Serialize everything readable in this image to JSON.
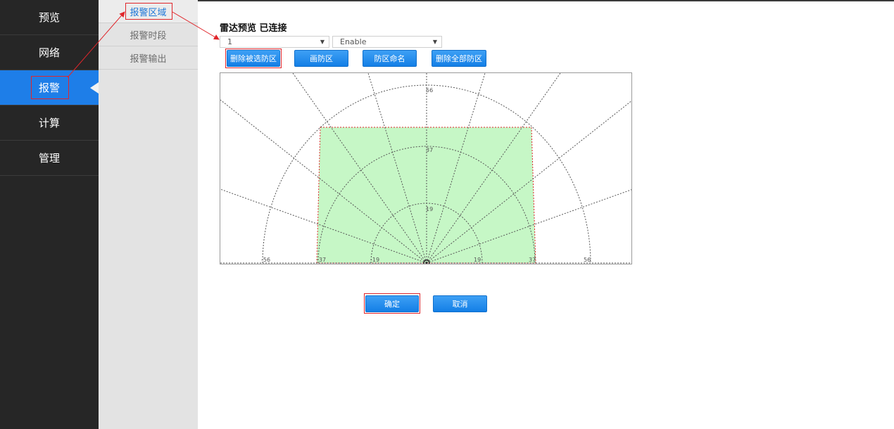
{
  "sidebar": {
    "items": [
      {
        "label": "预览"
      },
      {
        "label": "网络"
      },
      {
        "label": "报警",
        "active": true
      },
      {
        "label": "计算"
      },
      {
        "label": "管理"
      }
    ]
  },
  "subnav": {
    "items": [
      {
        "label": "报警区域",
        "active": true
      },
      {
        "label": "报警时段"
      },
      {
        "label": "报警输出"
      }
    ]
  },
  "main": {
    "title": "雷达预览 已连接",
    "zone_select": {
      "value": "1"
    },
    "enable_select": {
      "value": "Enable"
    },
    "buttons": {
      "delete_selected": "删除被选防区",
      "draw": "画防区",
      "rename": "防区命名",
      "delete_all": "删除全部防区"
    },
    "radar": {
      "range_labels": [
        "56",
        "37",
        "19"
      ],
      "axis_labels": [
        "-56",
        "-37",
        "-19",
        "19",
        "37",
        "56"
      ]
    },
    "footer": {
      "ok": "确定",
      "cancel": "取消"
    }
  },
  "colors": {
    "accent": "#1e7ee8",
    "sidebar_bg": "#262626",
    "zone_fill": "#c6f7c6",
    "highlight": "#e0262b"
  }
}
